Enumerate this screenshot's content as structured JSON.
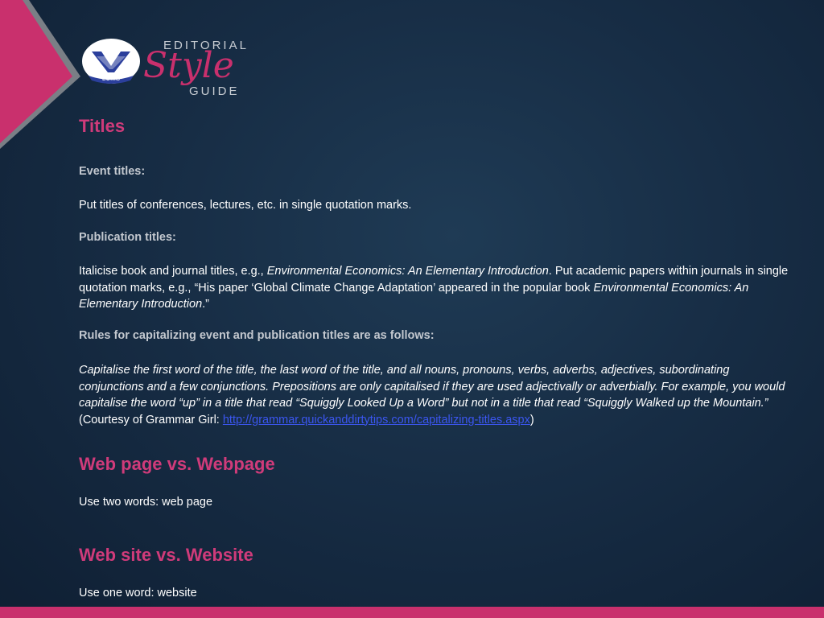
{
  "logo": {
    "seal_text": "LUMS",
    "editorial": "Editorial",
    "style": "Style",
    "guide": "Guide"
  },
  "sections": {
    "titles_heading": "Titles",
    "event_label": "Event  titles:",
    "event_text": "Put titles of conferences, lectures, etc. in single quotation marks.",
    "pub_label": "Publication titles:",
    "pub_p1": "Italicise book and journal titles, e.g., ",
    "pub_italic1": "Environmental Economics: An Elementary Introduction",
    "pub_p2": ". Put academic papers within journals in single quotation marks, e.g., “His paper ‘Global Climate Change Adaptation’ appeared in the popular book ",
    "pub_italic2": "Environmental Economics: An Elementary Introduction",
    "pub_p3": ".”",
    "rules_label": "Rules for capitalizing event and publication titles are as follows:",
    "rules_italic": "Capitalise the first word of the title, the last word of the title, and all nouns, pronouns, verbs, adverbs, adjectives, subordinating conjunctions and a few conjunctions. Prepositions are only capitalised if they are used adjectivally or adverbially. For example, you would capitalise the word “up” in a title that read “Squiggly Looked Up a Word” but not in a title that read “Squiggly Walked up the Mountain.”",
    "rules_courtesy": " (Courtesy of Grammar Girl: ",
    "rules_link": "http://grammar.quickanddirtytips.com/capitalizing-titles.aspx",
    "rules_close": ")",
    "webpage_heading": "Web  page vs. Webpage",
    "webpage_text": "Use two words: web page",
    "website_heading": "Web  site vs. Website",
    "website_text": "Use one word: website"
  },
  "colors": {
    "accent": "#c9306d",
    "heading": "#cf3b7a",
    "link": "#3b56f0",
    "background": "#172d45"
  }
}
